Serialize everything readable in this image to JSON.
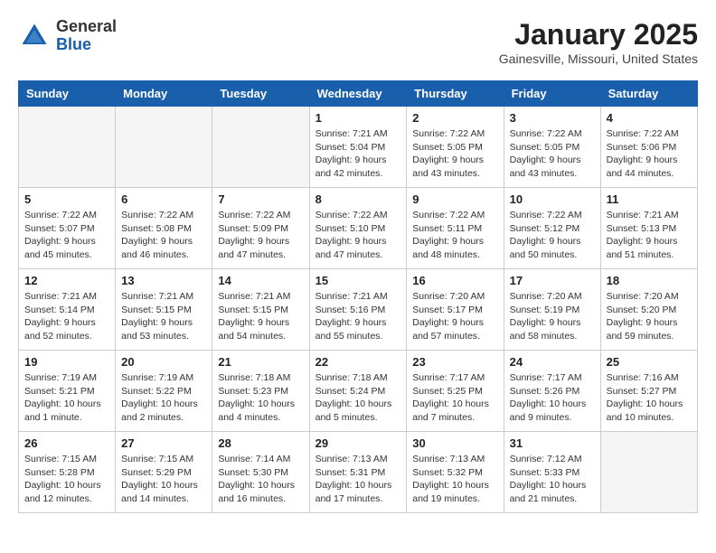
{
  "header": {
    "logo_general": "General",
    "logo_blue": "Blue",
    "month_title": "January 2025",
    "location": "Gainesville, Missouri, United States"
  },
  "days_of_week": [
    "Sunday",
    "Monday",
    "Tuesday",
    "Wednesday",
    "Thursday",
    "Friday",
    "Saturday"
  ],
  "weeks": [
    [
      {
        "day": "",
        "empty": true
      },
      {
        "day": "",
        "empty": true
      },
      {
        "day": "",
        "empty": true
      },
      {
        "day": "1",
        "sunrise": "7:21 AM",
        "sunset": "5:04 PM",
        "daylight": "9 hours and 42 minutes."
      },
      {
        "day": "2",
        "sunrise": "7:22 AM",
        "sunset": "5:05 PM",
        "daylight": "9 hours and 43 minutes."
      },
      {
        "day": "3",
        "sunrise": "7:22 AM",
        "sunset": "5:05 PM",
        "daylight": "9 hours and 43 minutes."
      },
      {
        "day": "4",
        "sunrise": "7:22 AM",
        "sunset": "5:06 PM",
        "daylight": "9 hours and 44 minutes."
      }
    ],
    [
      {
        "day": "5",
        "sunrise": "7:22 AM",
        "sunset": "5:07 PM",
        "daylight": "9 hours and 45 minutes."
      },
      {
        "day": "6",
        "sunrise": "7:22 AM",
        "sunset": "5:08 PM",
        "daylight": "9 hours and 46 minutes."
      },
      {
        "day": "7",
        "sunrise": "7:22 AM",
        "sunset": "5:09 PM",
        "daylight": "9 hours and 47 minutes."
      },
      {
        "day": "8",
        "sunrise": "7:22 AM",
        "sunset": "5:10 PM",
        "daylight": "9 hours and 47 minutes."
      },
      {
        "day": "9",
        "sunrise": "7:22 AM",
        "sunset": "5:11 PM",
        "daylight": "9 hours and 48 minutes."
      },
      {
        "day": "10",
        "sunrise": "7:22 AM",
        "sunset": "5:12 PM",
        "daylight": "9 hours and 50 minutes."
      },
      {
        "day": "11",
        "sunrise": "7:21 AM",
        "sunset": "5:13 PM",
        "daylight": "9 hours and 51 minutes."
      }
    ],
    [
      {
        "day": "12",
        "sunrise": "7:21 AM",
        "sunset": "5:14 PM",
        "daylight": "9 hours and 52 minutes."
      },
      {
        "day": "13",
        "sunrise": "7:21 AM",
        "sunset": "5:15 PM",
        "daylight": "9 hours and 53 minutes."
      },
      {
        "day": "14",
        "sunrise": "7:21 AM",
        "sunset": "5:15 PM",
        "daylight": "9 hours and 54 minutes."
      },
      {
        "day": "15",
        "sunrise": "7:21 AM",
        "sunset": "5:16 PM",
        "daylight": "9 hours and 55 minutes."
      },
      {
        "day": "16",
        "sunrise": "7:20 AM",
        "sunset": "5:17 PM",
        "daylight": "9 hours and 57 minutes."
      },
      {
        "day": "17",
        "sunrise": "7:20 AM",
        "sunset": "5:19 PM",
        "daylight": "9 hours and 58 minutes."
      },
      {
        "day": "18",
        "sunrise": "7:20 AM",
        "sunset": "5:20 PM",
        "daylight": "9 hours and 59 minutes."
      }
    ],
    [
      {
        "day": "19",
        "sunrise": "7:19 AM",
        "sunset": "5:21 PM",
        "daylight": "10 hours and 1 minute."
      },
      {
        "day": "20",
        "sunrise": "7:19 AM",
        "sunset": "5:22 PM",
        "daylight": "10 hours and 2 minutes."
      },
      {
        "day": "21",
        "sunrise": "7:18 AM",
        "sunset": "5:23 PM",
        "daylight": "10 hours and 4 minutes."
      },
      {
        "day": "22",
        "sunrise": "7:18 AM",
        "sunset": "5:24 PM",
        "daylight": "10 hours and 5 minutes."
      },
      {
        "day": "23",
        "sunrise": "7:17 AM",
        "sunset": "5:25 PM",
        "daylight": "10 hours and 7 minutes."
      },
      {
        "day": "24",
        "sunrise": "7:17 AM",
        "sunset": "5:26 PM",
        "daylight": "10 hours and 9 minutes."
      },
      {
        "day": "25",
        "sunrise": "7:16 AM",
        "sunset": "5:27 PM",
        "daylight": "10 hours and 10 minutes."
      }
    ],
    [
      {
        "day": "26",
        "sunrise": "7:15 AM",
        "sunset": "5:28 PM",
        "daylight": "10 hours and 12 minutes."
      },
      {
        "day": "27",
        "sunrise": "7:15 AM",
        "sunset": "5:29 PM",
        "daylight": "10 hours and 14 minutes."
      },
      {
        "day": "28",
        "sunrise": "7:14 AM",
        "sunset": "5:30 PM",
        "daylight": "10 hours and 16 minutes."
      },
      {
        "day": "29",
        "sunrise": "7:13 AM",
        "sunset": "5:31 PM",
        "daylight": "10 hours and 17 minutes."
      },
      {
        "day": "30",
        "sunrise": "7:13 AM",
        "sunset": "5:32 PM",
        "daylight": "10 hours and 19 minutes."
      },
      {
        "day": "31",
        "sunrise": "7:12 AM",
        "sunset": "5:33 PM",
        "daylight": "10 hours and 21 minutes."
      },
      {
        "day": "",
        "empty": true
      }
    ]
  ]
}
